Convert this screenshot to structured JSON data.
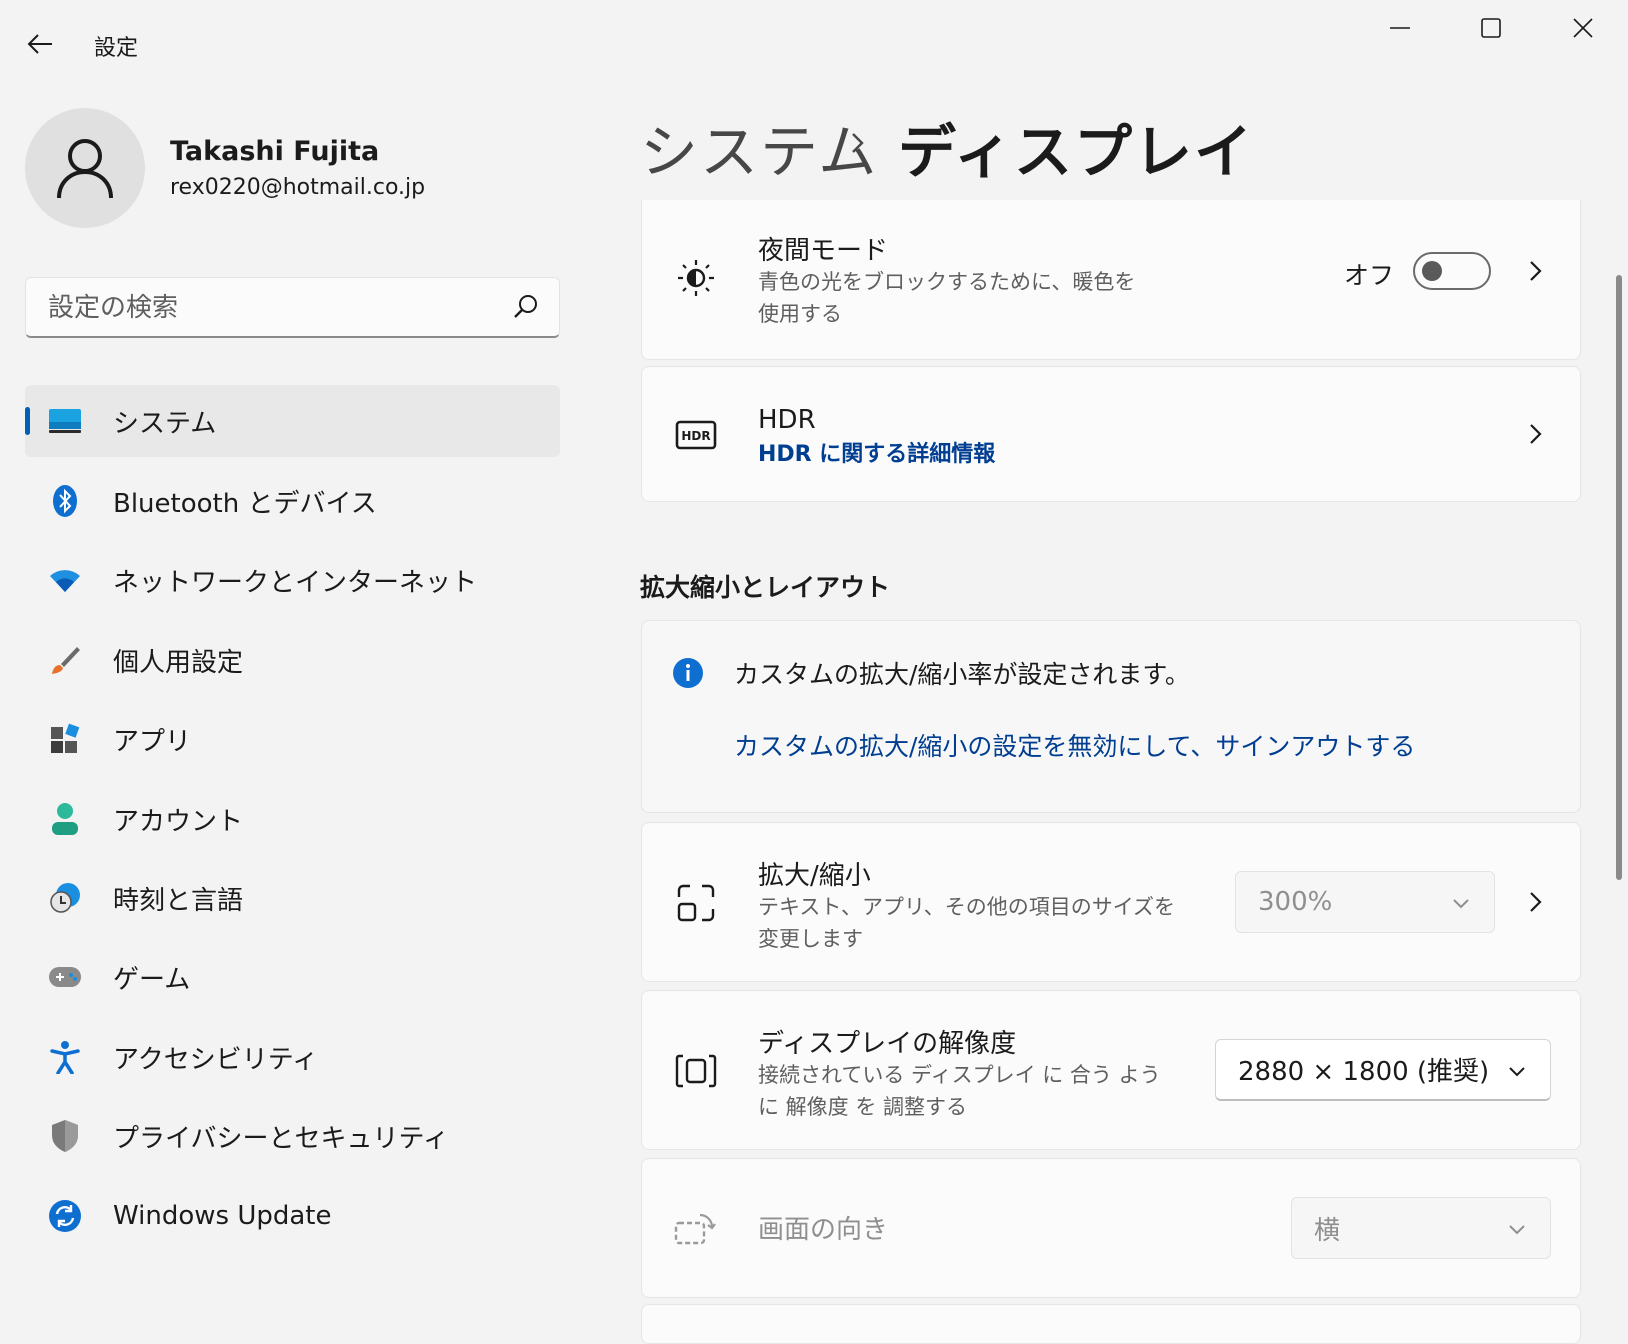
{
  "app": {
    "title": "設定"
  },
  "user": {
    "name": "Takashi Fujita",
    "email": "rex0220@hotmail.co.jp"
  },
  "search": {
    "placeholder": "設定の検索"
  },
  "sidebar": {
    "items": [
      {
        "label": "システム",
        "icon": "system-icon",
        "selected": true
      },
      {
        "label": "Bluetooth とデバイス",
        "icon": "bluetooth-icon"
      },
      {
        "label": "ネットワークとインターネット",
        "icon": "wifi-icon"
      },
      {
        "label": "個人用設定",
        "icon": "brush-icon"
      },
      {
        "label": "アプリ",
        "icon": "apps-icon"
      },
      {
        "label": "アカウント",
        "icon": "account-icon"
      },
      {
        "label": "時刻と言語",
        "icon": "time-language-icon"
      },
      {
        "label": "ゲーム",
        "icon": "gamepad-icon"
      },
      {
        "label": "アクセシビリティ",
        "icon": "accessibility-icon"
      },
      {
        "label": "プライバシーとセキュリティ",
        "icon": "shield-icon"
      },
      {
        "label": "Windows Update",
        "icon": "windows-update-icon"
      }
    ]
  },
  "breadcrumb": {
    "parent": "システム",
    "current": "ディスプレイ"
  },
  "night_mode": {
    "title": "夜間モード",
    "desc": "青色の光をブロックするために、暖色を使用する",
    "state_label": "オフ",
    "enabled": false
  },
  "hdr": {
    "title": "HDR",
    "link": "HDR に関する詳細情報"
  },
  "scale_section": {
    "title": "拡大縮小とレイアウト"
  },
  "info": {
    "message": "カスタムの拡大/縮小率が設定されます。",
    "link": "カスタムの拡大/縮小の設定を無効にして、サインアウトする"
  },
  "scale": {
    "title": "拡大/縮小",
    "desc": "テキスト、アプリ、その他の項目のサイズを変更します",
    "value": "300%"
  },
  "resolution": {
    "title": "ディスプレイの解像度",
    "desc": "接続されている ディスプレイ に 合う ように 解像度 を 調整する",
    "value": "2880 × 1800 (推奨)"
  },
  "orientation": {
    "title": "画面の向き",
    "value": "横"
  },
  "colors": {
    "accent": "#005fb8",
    "link": "#003e92",
    "background": "#f3f3f3",
    "card": "#fbfbfb"
  }
}
